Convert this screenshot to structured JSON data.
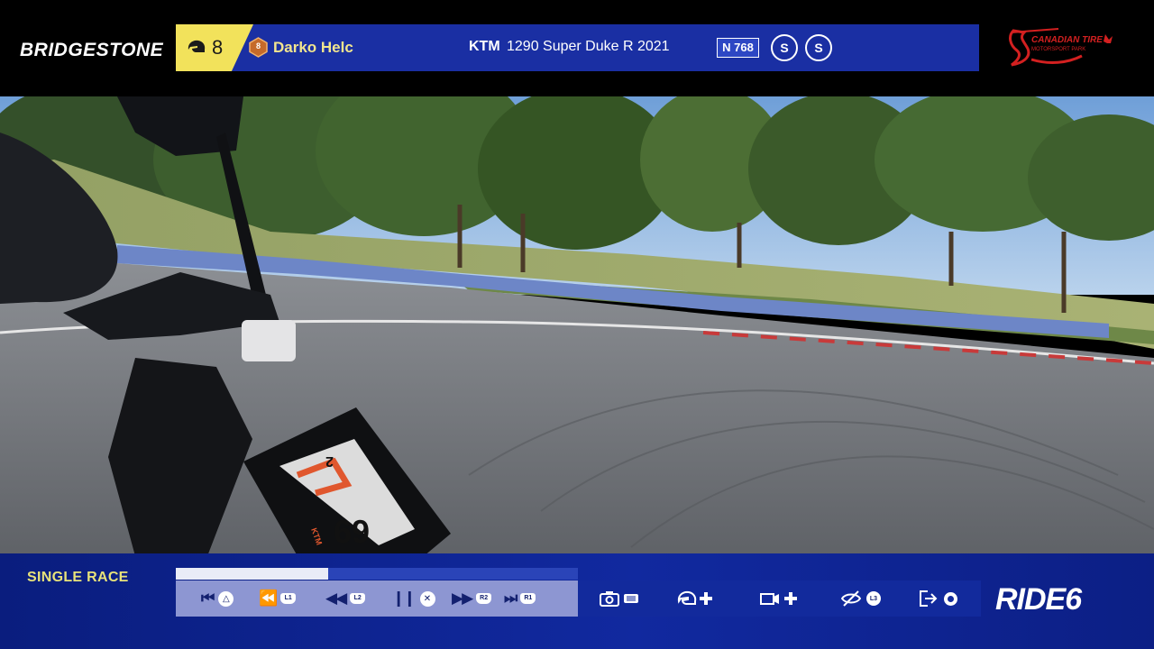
{
  "top_bar": {
    "sponsor_left": "BRIDGESTONE",
    "sponsor_right_line1": "CANADIAN TIRE",
    "sponsor_right_line2": "MOTORSPORT PARK",
    "position_icon": "helmet-icon",
    "position": "8",
    "rider_number": "8",
    "rider_name": "Darko Helc",
    "bike_brand": "KTM",
    "bike_model": "1290 Super Duke R 2021",
    "plate": "N 768",
    "tyre_front": "S",
    "tyre_rear": "S"
  },
  "replay": {
    "mode_label": "SINGLE RACE",
    "progress_percent": 38,
    "controls": [
      {
        "name": "restart",
        "glyph": "⏮",
        "button": "△",
        "button_type": "round"
      },
      {
        "name": "rewind-fast",
        "glyph": "⏪",
        "button": "L1",
        "button_type": "pill"
      },
      {
        "name": "rewind",
        "glyph": "◀◀",
        "button": "L2",
        "button_type": "pill"
      },
      {
        "name": "pause",
        "glyph": "❙❙",
        "button": "✕",
        "button_type": "round"
      },
      {
        "name": "forward",
        "glyph": "▶▶",
        "button": "R2",
        "button_type": "pill"
      },
      {
        "name": "forward-fast",
        "glyph": "⏭",
        "button": "R1",
        "button_type": "pill"
      }
    ],
    "tools": [
      {
        "name": "photo-mode",
        "icon": "camera-icon",
        "button": "touchpad"
      },
      {
        "name": "rider-select",
        "icon": "helmet-icon",
        "button": "dpad"
      },
      {
        "name": "camera-select",
        "icon": "video-camera-icon",
        "button": "dpad"
      },
      {
        "name": "hide-hud",
        "icon": "eye-slash-icon",
        "button": "L3"
      },
      {
        "name": "exit-replay",
        "icon": "exit-icon",
        "button": "options"
      }
    ],
    "brand_logo": "RIDE",
    "brand_logo_number": "6"
  },
  "dashboard": {
    "gear": "2",
    "speed": "69",
    "brand": "KTM"
  },
  "colors": {
    "top_strip": "#1a2fa3",
    "position_box": "#f2e25b",
    "rider_name": "#f1e58f",
    "mode_label": "#e8e27a",
    "controls_panel": "#8d96d2"
  }
}
